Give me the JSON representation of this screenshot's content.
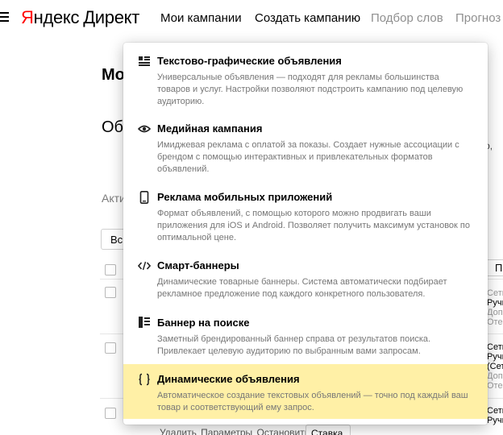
{
  "header": {
    "logo_yandex_first": "Я",
    "logo_yandex_rest": "ндекс",
    "logo_product": "Директ",
    "nav": [
      {
        "label": "Мои кампании"
      },
      {
        "label": "Создать кампанию"
      },
      {
        "label": "Подбор слов"
      },
      {
        "label": "Прогноз"
      }
    ]
  },
  "background": {
    "title": "Мо",
    "subtitle": "Об",
    "tab": "Акти",
    "select_label": "Вс",
    "right_text": "го,",
    "column_head": "Па",
    "row_tags": [
      [
        "Сети",
        "Ручн",
        "Доп",
        "Отен"
      ],
      [
        "Сети",
        "Ручн",
        "(Сети",
        "Доп",
        "Отен"
      ],
      [
        "Сети",
        "Ручн"
      ]
    ],
    "actions": [
      "Удалить",
      "Параметры",
      "Остановить"
    ],
    "status_button": "Ставка"
  },
  "dropdown": {
    "items": [
      {
        "icon": "text-graphic-icon",
        "title": "Текстово-графические объявления",
        "desc": "Универсальные объявления — подходят для рекламы большинства товаров и услуг. Настройки позволяют подстроить кампанию под целевую аудиторию."
      },
      {
        "icon": "eye-icon",
        "title": "Медийная кампания",
        "desc": "Имиджевая реклама с оплатой за показы. Создает нужные ассоциации с брендом с помощью интерактивных и привлекательных форматов объявлений."
      },
      {
        "icon": "mobile-phone-icon",
        "title": "Реклама мобильных приложений",
        "desc": "Формат объявлений, с помощью которого можно продвигать ваши приложения для iOS и Android. Позволяет получить максимум установок по оптимальной цене."
      },
      {
        "icon": "code-brackets-icon",
        "title": "Смарт-баннеры",
        "desc": "Динамические товарные баннеры. Система автоматически подбирает рекламное предложение под каждого конкретного пользователя."
      },
      {
        "icon": "search-banner-icon",
        "title": "Баннер на поиске",
        "desc": "Заметный брендированный баннер справа от результатов поиска. Привлекает целевую аудиторию по выбранным вами запросам."
      },
      {
        "icon": "curly-braces-icon",
        "title": "Динамические объявления",
        "desc": "Автоматическое создание текстовых объявлений — точно под каждый ваш товар и соответствующий ему запрос."
      }
    ]
  },
  "colors": {
    "logo_red": "#ff0000",
    "highlight": "#fff0a6",
    "muted_text": "#777777"
  }
}
